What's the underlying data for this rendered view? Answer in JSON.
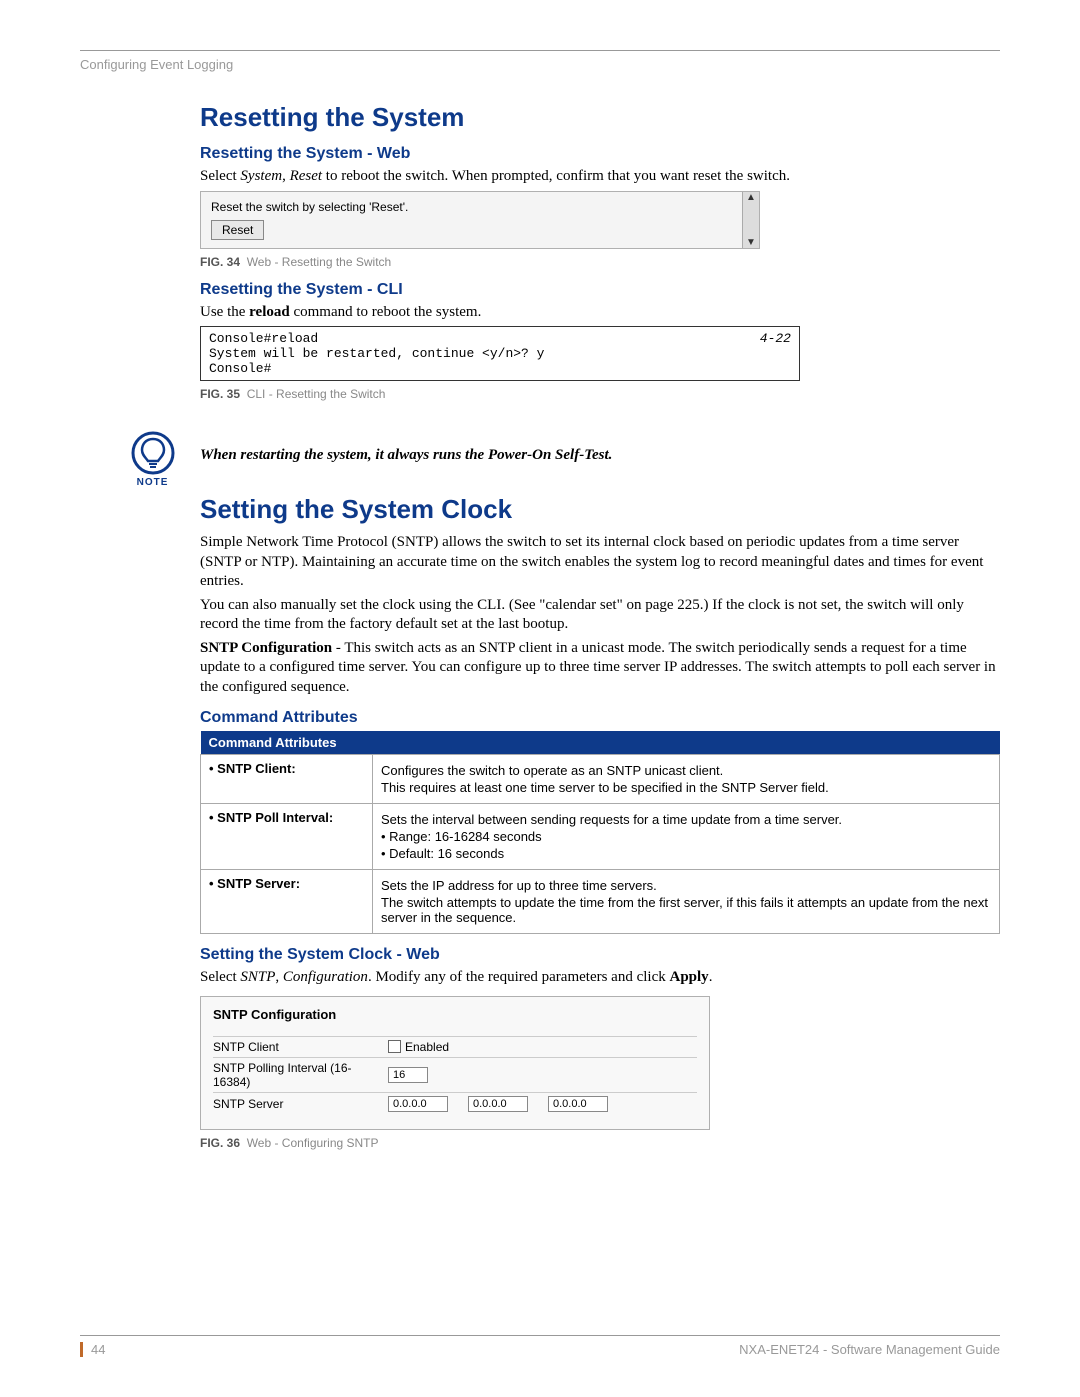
{
  "runningHead": "Configuring Event Logging",
  "section1": {
    "title": "Resetting the System",
    "webHeading": "Resetting the System - Web",
    "webText_pre": "Select ",
    "webText_i1": "System",
    "webText_mid": ", ",
    "webText_i2": "Reset",
    "webText_post": " to reboot the switch. When prompted, confirm that you want reset the switch.",
    "fig34": {
      "boxText": "Reset the switch by selecting 'Reset'.",
      "button": "Reset",
      "label": "FIG. 34",
      "caption": "Web - Resetting the Switch"
    },
    "cliHeading": "Resetting the System - CLI",
    "cliText_pre": "Use the ",
    "cliText_bold": "reload",
    "cliText_post": " command to reboot the system.",
    "cliBox": {
      "left": "Console#reload\nSystem will be restarted, continue <y/n>? y\nConsole#",
      "right": "4-22"
    },
    "fig35": {
      "label": "FIG. 35",
      "caption": "CLI - Resetting the Switch"
    }
  },
  "note": {
    "label": "NOTE",
    "text": "When restarting the system, it always runs the Power-On Self-Test."
  },
  "section2": {
    "title": "Setting the System Clock",
    "para1": "Simple Network Time Protocol (SNTP) allows the switch to set its internal clock based on periodic updates from a time server (SNTP or NTP). Maintaining an accurate time on the switch enables the system log to record meaningful dates and times for event entries.",
    "para2": "You can also manually set the clock using the CLI. (See \"calendar set\" on page 225.) If the clock is not set, the switch will only record the time from the factory default set at the last bootup.",
    "para3_bold": "SNTP Configuration",
    "para3_rest": " - This switch acts as an SNTP client in a unicast mode. The switch periodically sends a request for a time update to a configured time server. You can configure up to three time server IP addresses. The switch attempts to poll each server in the configured sequence.",
    "attrsHeading": "Command Attributes",
    "tableHeader": "Command Attributes",
    "rows": [
      {
        "key": "• SNTP Client:",
        "lines": [
          "Configures the switch to operate as an SNTP unicast client.",
          "This requires at least one time server to be specified in the SNTP Server field."
        ]
      },
      {
        "key": "• SNTP Poll Interval:",
        "lines": [
          "Sets the interval between sending requests for a time update from a time server.",
          "• Range: 16-16284 seconds",
          "• Default: 16 seconds"
        ]
      },
      {
        "key": "• SNTP Server:",
        "lines": [
          "Sets the IP address for up to three time servers.",
          "The switch attempts to update the time from the first server, if this fails it attempts an update from the next server in the sequence."
        ]
      }
    ],
    "clockWebHeading": "Setting the System Clock - Web",
    "clockWebText_pre": "Select ",
    "clockWebText_i1": "SNTP",
    "clockWebText_mid": ", ",
    "clockWebText_i2": "Configuration",
    "clockWebText_post": ". Modify any of the required parameters and click ",
    "clockWebText_bold": "Apply",
    "clockWebText_end": ".",
    "sntpBox": {
      "title": "SNTP Configuration",
      "row1Label": "SNTP Client",
      "row1Check": "Enabled",
      "row2Label": "SNTP Polling Interval (16-16384)",
      "row2Value": "16",
      "row3Label": "SNTP Server",
      "row3Values": [
        "0.0.0.0",
        "0.0.0.0",
        "0.0.0.0"
      ]
    },
    "fig36": {
      "label": "FIG. 36",
      "caption": "Web - Configuring SNTP"
    }
  },
  "footer": {
    "pageNum": "44",
    "right": "NXA-ENET24 - Software Management Guide"
  }
}
